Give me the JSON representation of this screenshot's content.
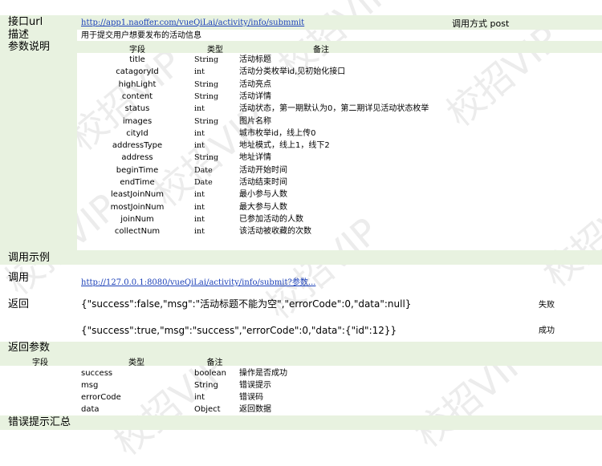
{
  "api": {
    "url_label": "接口url",
    "url": "http://app1.naoffer.com/vueQiLai/activity/info/submmit",
    "method_label": "调用方式 post",
    "desc_label": "描述",
    "desc": "用于提交用户想要发布的活动信息",
    "params_label": "参数说明"
  },
  "params_header": {
    "field": "字段",
    "type": "类型",
    "note": "备注"
  },
  "params": [
    {
      "field": "title",
      "type": "String",
      "note": "活动标题"
    },
    {
      "field": "catagoryId",
      "type": "int",
      "note": "活动分类枚举id,见初始化接口"
    },
    {
      "field": "highLight",
      "type": "String",
      "note": "活动亮点"
    },
    {
      "field": "content",
      "type": "String",
      "note": "活动详情"
    },
    {
      "field": "status",
      "type": "int",
      "note": "活动状态，第一期默认为0，第二期详见活动状态枚举"
    },
    {
      "field": "images",
      "type": "String",
      "note": "图片名称"
    },
    {
      "field": "cityId",
      "type": "int",
      "note": "城市枚举id，线上传0"
    },
    {
      "field": "addressType",
      "type": "int",
      "note": "地址模式，线上1，线下2"
    },
    {
      "field": "address",
      "type": "String",
      "note": "地址详情"
    },
    {
      "field": "beginTime",
      "type": "Date",
      "note": "活动开始时间"
    },
    {
      "field": "endTime",
      "type": "Date",
      "note": "活动结束时间"
    },
    {
      "field": "leastJoinNum",
      "type": "int",
      "note": "最小参与人数"
    },
    {
      "field": "mostJoinNum",
      "type": "int",
      "note": "最大参与人数"
    },
    {
      "field": "joinNum",
      "type": "int",
      "note": "已参加活动的人数"
    },
    {
      "field": "collectNum",
      "type": "int",
      "note": "该活动被收藏的次数"
    }
  ],
  "example": {
    "section_label": "调用示例",
    "call_label": "调用",
    "call_url": "http://127.0.0.1:8080/vueQiLai/activity/info/submit?参数...",
    "return_label": "返回",
    "fail_json": "{\"success\":false,\"msg\":\"活动标题不能为空\",\"errorCode\":0,\"data\":null}",
    "fail_label": "失败",
    "ok_json": "{\"success\":true,\"msg\":\"success\",\"errorCode\":0,\"data\":{\"id\":12}}",
    "ok_label": "成功"
  },
  "return_params": {
    "section_label": "返回参数",
    "header": {
      "field": "字段",
      "type": "类型",
      "note": "备注"
    },
    "rows": [
      {
        "field": "success",
        "type": "boolean",
        "note": "操作是否成功"
      },
      {
        "field": "msg",
        "type": "String",
        "note": "错误提示"
      },
      {
        "field": "errorCode",
        "type": "int",
        "note": "错误码"
      },
      {
        "field": "data",
        "type": "Object",
        "note": "返回数据"
      }
    ]
  },
  "errors_label": "错误提示汇总",
  "watermark": "校招VIP"
}
